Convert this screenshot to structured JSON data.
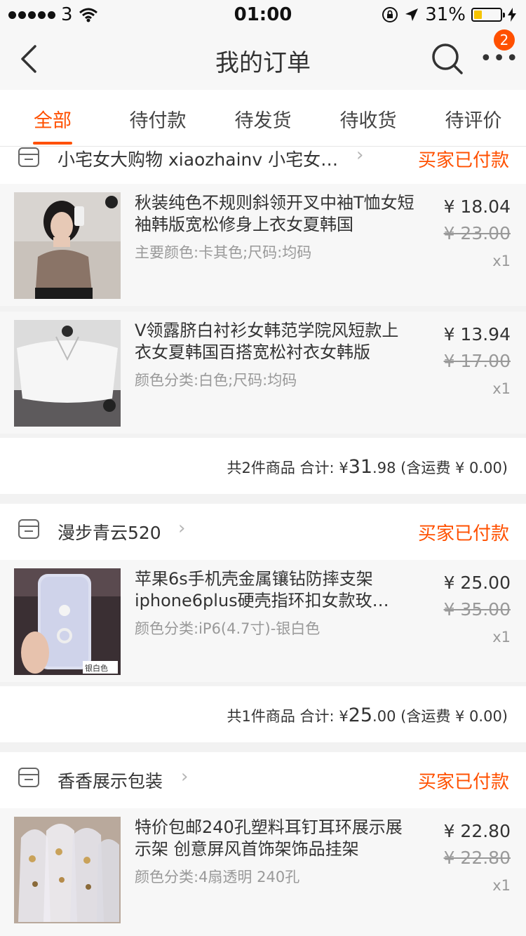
{
  "status_bar": {
    "carrier": "3",
    "time": "01:00",
    "battery": "31%",
    "battery_level": 0.31
  },
  "nav": {
    "title": "我的订单",
    "badge": "2"
  },
  "tabs": [
    {
      "label": "全部"
    },
    {
      "label": "待付款"
    },
    {
      "label": "待发货"
    },
    {
      "label": "待收货"
    },
    {
      "label": "待评价"
    }
  ],
  "orders": [
    {
      "shop": "小宅女大购物 xiaozhainv 小宅女…",
      "status": "买家已付款",
      "items": [
        {
          "title": "秋装纯色不规则斜领开叉中袖T恤女短袖韩版宽松修身上衣女夏韩国",
          "sku": "主要颜色:卡其色;尺码:均码",
          "price": "¥ 18.04",
          "orig_price": "¥ 23.00",
          "qty": "x1"
        },
        {
          "title": "V领露脐白衬衫女韩范学院风短款上衣女夏韩国百搭宽松衬衣女韩版",
          "sku": "颜色分类:白色;尺码:均码",
          "price": "¥ 13.94",
          "orig_price": "¥ 17.00",
          "qty": "x1"
        }
      ],
      "summary": {
        "count": "共2件商品",
        "label": "合计:",
        "currency": "¥",
        "int": "31",
        "dec": ".98",
        "shipping": "(含运费 ¥ 0.00)"
      }
    },
    {
      "shop": "漫步青云520",
      "status": "买家已付款",
      "items": [
        {
          "title": "苹果6s手机壳金属镶钻防摔支架iphone6plus硬壳指环扣女款玫…",
          "sku": "颜色分类:iP6(4.7寸)-银白色",
          "price": "¥ 25.00",
          "orig_price": "¥ 35.00",
          "qty": "x1",
          "thumb_tag": "银白色"
        }
      ],
      "summary": {
        "count": "共1件商品",
        "label": "合计:",
        "currency": "¥",
        "int": "25",
        "dec": ".00",
        "shipping": "(含运费 ¥ 0.00)"
      }
    },
    {
      "shop": "香香展示包装",
      "status": "买家已付款",
      "items": [
        {
          "title": "特价包邮240孔塑料耳钉耳环展示展示架 创意屏风首饰架饰品挂架",
          "sku": "颜色分类:4扇透明 240孔",
          "price": "¥ 22.80",
          "orig_price": "¥ 22.80",
          "qty": "x1"
        }
      ]
    }
  ],
  "colors": {
    "accent": "#ff5000",
    "text": "#333333",
    "muted": "#999999"
  }
}
